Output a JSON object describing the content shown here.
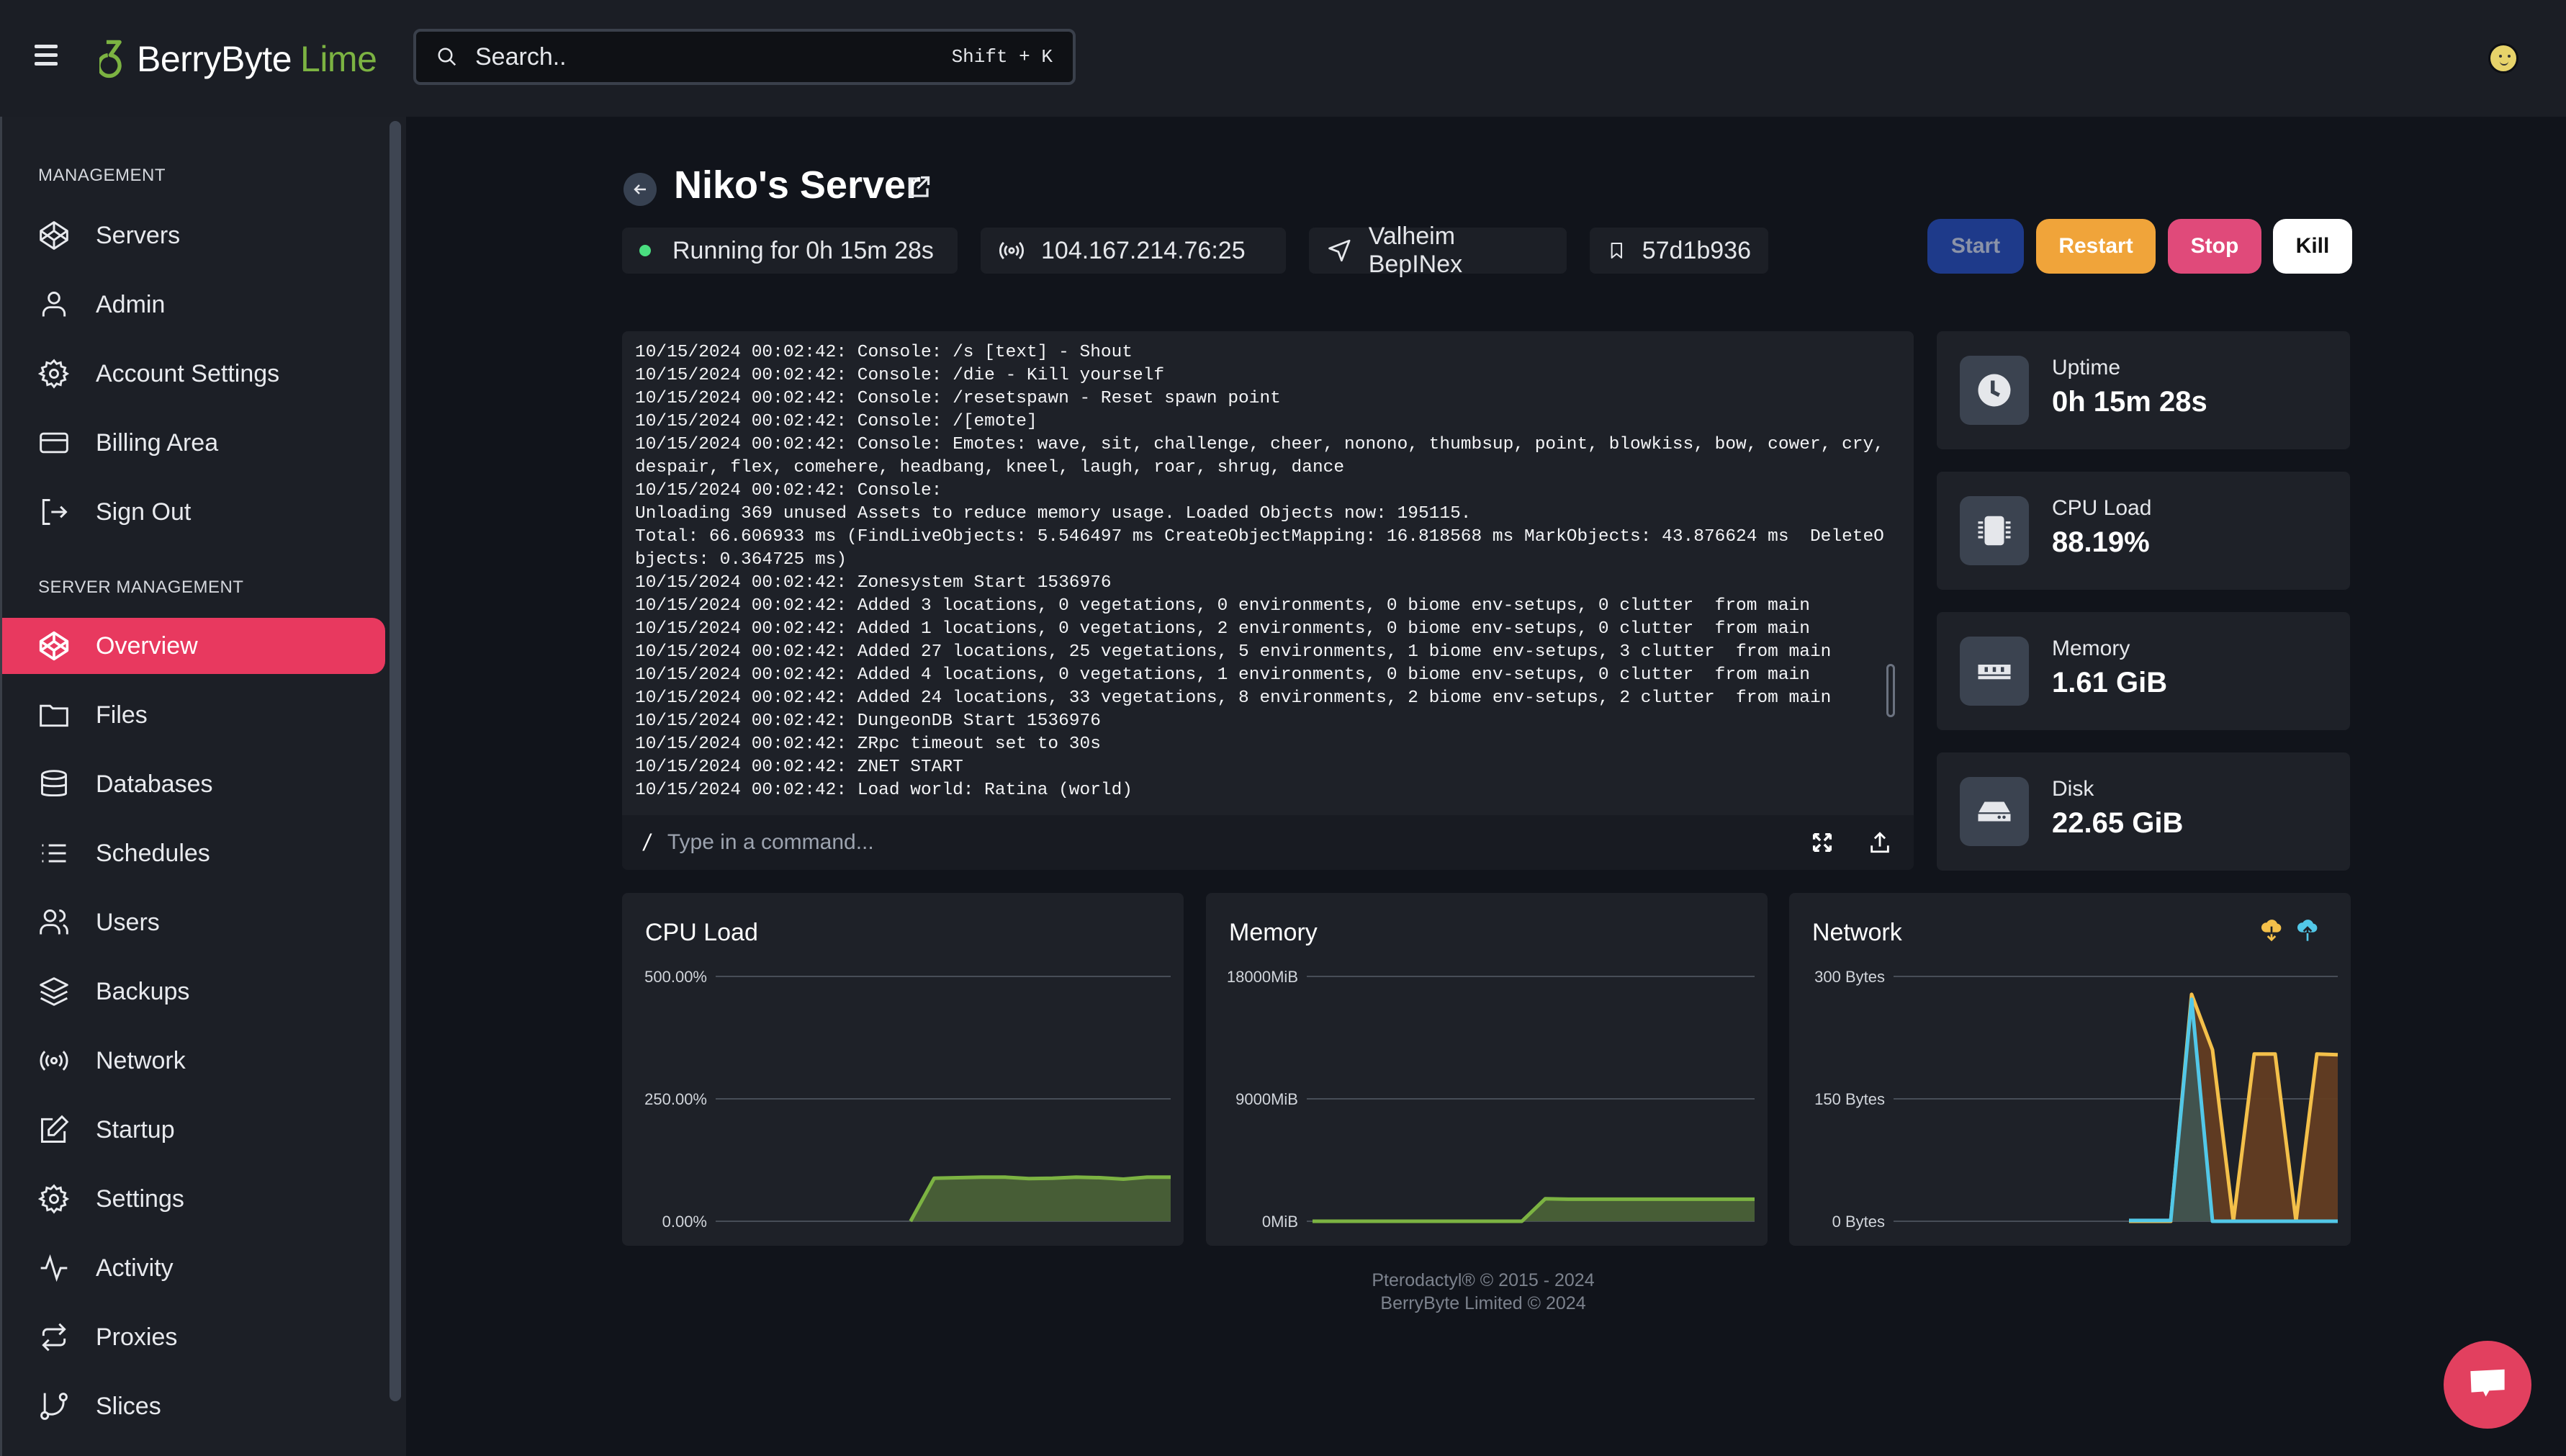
{
  "topbar": {
    "brand_main": "BerryByte",
    "brand_accent": "Lime",
    "search_placeholder": "Search..",
    "search_shortcut": "Shift + K"
  },
  "sidebar": {
    "sections": [
      {
        "label": "MANAGEMENT",
        "items": [
          {
            "label": "Servers",
            "icon": "cube-icon"
          },
          {
            "label": "Admin",
            "icon": "user-icon"
          },
          {
            "label": "Account Settings",
            "icon": "gear-icon"
          },
          {
            "label": "Billing Area",
            "icon": "credit-card-icon"
          },
          {
            "label": "Sign Out",
            "icon": "sign-out-icon"
          }
        ]
      },
      {
        "label": "SERVER MANAGEMENT",
        "items": [
          {
            "label": "Overview",
            "icon": "cube-icon",
            "active": true
          },
          {
            "label": "Files",
            "icon": "folder-icon"
          },
          {
            "label": "Databases",
            "icon": "database-icon"
          },
          {
            "label": "Schedules",
            "icon": "list-icon"
          },
          {
            "label": "Users",
            "icon": "users-icon"
          },
          {
            "label": "Backups",
            "icon": "layers-icon"
          },
          {
            "label": "Network",
            "icon": "broadcast-icon"
          },
          {
            "label": "Startup",
            "icon": "edit-icon"
          },
          {
            "label": "Settings",
            "icon": "gear-icon"
          },
          {
            "label": "Activity",
            "icon": "pulse-icon"
          },
          {
            "label": "Proxies",
            "icon": "arrows-repeat-icon"
          },
          {
            "label": "Slices",
            "icon": "git-branch-icon"
          }
        ]
      }
    ]
  },
  "server": {
    "name": "Niko's Server",
    "status_text": "Running for 0h 15m 28s",
    "status_color": "#4ade80",
    "address": "104.167.214.76:25",
    "egg": "Valheim BepINex",
    "id": "57d1b936"
  },
  "power": {
    "start": {
      "label": "Start",
      "bg": "#1e3a8a",
      "fg": "#8b93a8"
    },
    "restart": {
      "label": "Restart",
      "bg": "#f0a43a",
      "fg": "#ffffff"
    },
    "stop": {
      "label": "Stop",
      "bg": "#e04a7a",
      "fg": "#ffffff"
    },
    "kill": {
      "label": "Kill",
      "bg": "#ffffff",
      "fg": "#111111"
    }
  },
  "console": {
    "lines": [
      "10/15/2024 00:02:42: Console: /s [text] - Shout",
      "10/15/2024 00:02:42: Console: /die - Kill yourself",
      "10/15/2024 00:02:42: Console: /resetspawn - Reset spawn point",
      "10/15/2024 00:02:42: Console: /[emote]",
      "10/15/2024 00:02:42: Console: Emotes: wave, sit, challenge, cheer, nonono, thumbsup, point, blowkiss, bow, cower, cry, despair, flex, comehere, headbang, kneel, laugh, roar, shrug, dance",
      "10/15/2024 00:02:42: Console:",
      "Unloading 369 unused Assets to reduce memory usage. Loaded Objects now: 195115.",
      "Total: 66.606933 ms (FindLiveObjects: 5.546497 ms CreateObjectMapping: 16.818568 ms MarkObjects: 43.876624 ms  DeleteObjects: 0.364725 ms)",
      "10/15/2024 00:02:42: Zonesystem Start 1536976",
      "10/15/2024 00:02:42: Added 3 locations, 0 vegetations, 0 environments, 0 biome env-setups, 0 clutter  from main",
      "10/15/2024 00:02:42: Added 1 locations, 0 vegetations, 2 environments, 0 biome env-setups, 0 clutter  from main",
      "10/15/2024 00:02:42: Added 27 locations, 25 vegetations, 5 environments, 1 biome env-setups, 3 clutter  from main",
      "10/15/2024 00:02:42: Added 4 locations, 0 vegetations, 1 environments, 0 biome env-setups, 0 clutter  from main",
      "10/15/2024 00:02:42: Added 24 locations, 33 vegetations, 8 environments, 2 biome env-setups, 2 clutter  from main",
      "10/15/2024 00:02:42: DungeonDB Start 1536976",
      "10/15/2024 00:02:42: ZRpc timeout set to 30s",
      "10/15/2024 00:02:42: ZNET START",
      "10/15/2024 00:02:42: Load world: Ratina (world)"
    ],
    "prompt": "/",
    "input_placeholder": "Type in a command..."
  },
  "stats": [
    {
      "label": "Uptime",
      "value": "0h 15m 28s",
      "icon": "clock-icon"
    },
    {
      "label": "CPU Load",
      "value": "88.19%",
      "icon": "cpu-icon"
    },
    {
      "label": "Memory",
      "value": "1.61 GiB",
      "icon": "memory-icon"
    },
    {
      "label": "Disk",
      "value": "22.65 GiB",
      "icon": "hard-drive-icon"
    }
  ],
  "chart_data": [
    {
      "type": "area",
      "title": "CPU Load",
      "ylabel": "",
      "ylim": [
        0,
        500
      ],
      "yticks": [
        "0.00%",
        "250.00%",
        "500.00%"
      ],
      "grid": true,
      "series": [
        {
          "name": "CPU",
          "color": "#7cb342",
          "fill": "#4a6137",
          "values": [
            null,
            null,
            null,
            null,
            null,
            null,
            null,
            null,
            0,
            88,
            89,
            90,
            90,
            87,
            88,
            90,
            89,
            86,
            90,
            90
          ]
        }
      ]
    },
    {
      "type": "area",
      "title": "Memory",
      "ylim": [
        0,
        18000
      ],
      "yticks": [
        "0MiB",
        "9000MiB",
        "18000MiB"
      ],
      "grid": true,
      "series": [
        {
          "name": "Memory",
          "color": "#7cb342",
          "fill": "#4a6137",
          "values": [
            0,
            0,
            0,
            0,
            0,
            0,
            0,
            0,
            0,
            0,
            1650,
            1620,
            1620,
            1620,
            1620,
            1620,
            1620,
            1620,
            1620,
            1620
          ]
        }
      ]
    },
    {
      "type": "area",
      "title": "Network",
      "ylim": [
        0,
        300
      ],
      "yticks": [
        "0 Bytes",
        "150 Bytes",
        "300 Bytes"
      ],
      "grid": true,
      "legend": "top-right",
      "series": [
        {
          "name": "Inbound",
          "color": "#f4c04a",
          "fill": "#633d22",
          "values": [
            null,
            null,
            null,
            null,
            null,
            null,
            null,
            null,
            null,
            null,
            null,
            0,
            0,
            0,
            278,
            210,
            0,
            205,
            205,
            0,
            205,
            204
          ]
        },
        {
          "name": "Outbound",
          "color": "#52c8e8",
          "fill": "#3f5350",
          "values": [
            null,
            null,
            null,
            null,
            null,
            null,
            null,
            null,
            null,
            null,
            null,
            1,
            1,
            1,
            272,
            0,
            0,
            0,
            0,
            0,
            0,
            0
          ]
        }
      ]
    }
  ],
  "footer": {
    "line1": "Pterodactyl® © 2015 - 2024",
    "line2": "BerryByte Limited © 2024"
  }
}
